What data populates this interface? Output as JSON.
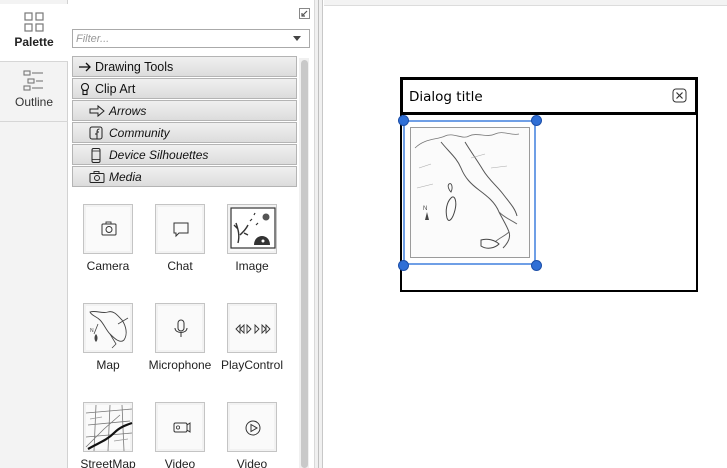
{
  "rail": {
    "tabs": [
      {
        "label": "Palette",
        "icon": "grid-icon",
        "active": true
      },
      {
        "label": "Outline",
        "icon": "outline-list-icon",
        "active": false
      }
    ]
  },
  "palette": {
    "filter_placeholder": "Filter...",
    "sections": [
      {
        "label": "Drawing Tools",
        "icon": "arrow-right-icon"
      },
      {
        "label": "Clip Art",
        "icon": "lightbulb-icon"
      }
    ],
    "subsections": [
      {
        "label": "Arrows",
        "icon": "outline-arrow-icon"
      },
      {
        "label": "Community",
        "icon": "facebook-icon"
      },
      {
        "label": "Device Silhouettes",
        "icon": "phone-icon"
      },
      {
        "label": "Media",
        "icon": "camera-icon"
      }
    ],
    "tiles": [
      {
        "label": "Camera",
        "icon": "camera-icon"
      },
      {
        "label": "Chat",
        "icon": "chat-bubble-icon"
      },
      {
        "label": "Image",
        "icon": "image-icon"
      },
      {
        "label": "Map",
        "icon": "map-icon"
      },
      {
        "label": "Microphone",
        "icon": "microphone-icon"
      },
      {
        "label": "PlayControl",
        "icon": "play-control-icon"
      },
      {
        "label": "StreetMap",
        "icon": "street-map-icon"
      },
      {
        "label": "Video",
        "icon": "video-camera-icon"
      },
      {
        "label": "Video",
        "icon": "play-circle-icon"
      }
    ]
  },
  "canvas": {
    "dialog": {
      "title": "Dialog title",
      "close_icon": "close-icon"
    },
    "selected_element": "map",
    "selection_color": "#2f6fd6"
  }
}
